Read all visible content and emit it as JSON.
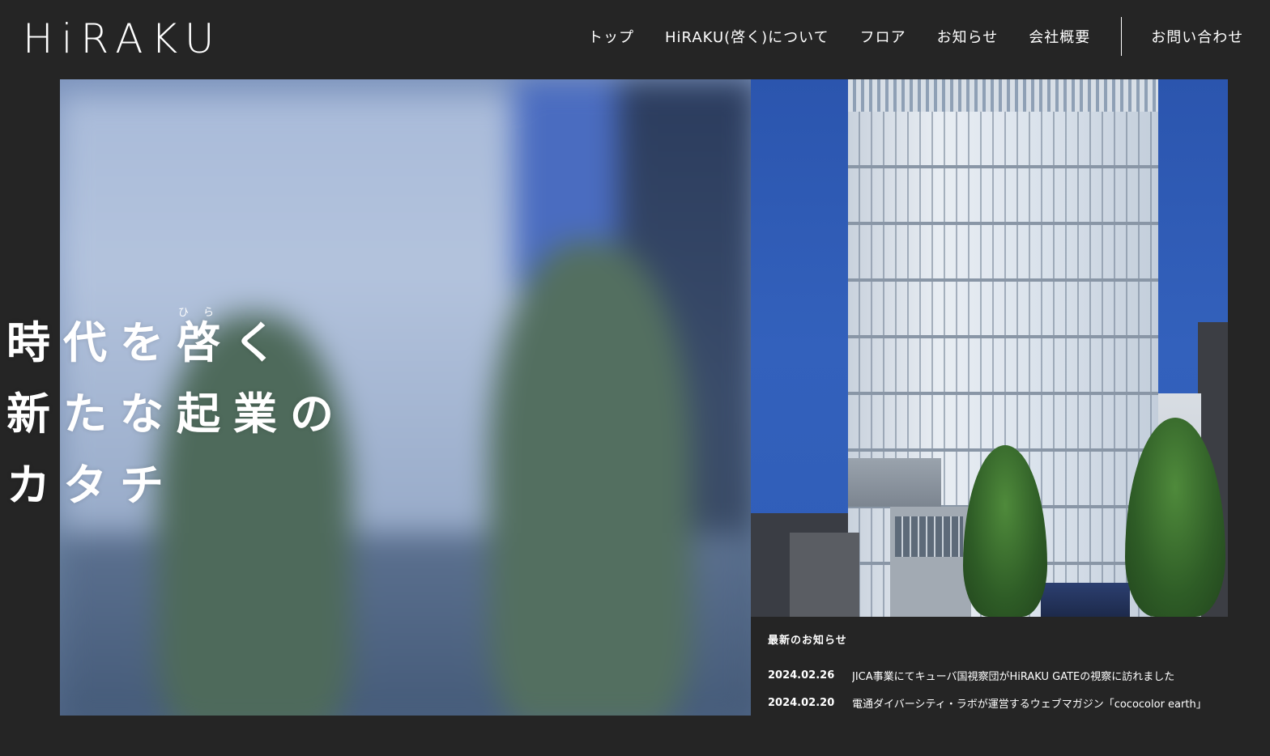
{
  "header": {
    "logo_text": "HiRAKU",
    "nav": [
      {
        "label": "トップ"
      },
      {
        "label": "HiRAKU(啓く)について"
      },
      {
        "label": "フロア"
      },
      {
        "label": "お知らせ"
      },
      {
        "label": "会社概要"
      },
      {
        "label": "お問い合わせ"
      }
    ]
  },
  "hero": {
    "ruby": "ひら",
    "line1": "時代を啓く",
    "line2": "新たな起業の",
    "line3": "カタチ"
  },
  "news": {
    "title": "最新のお知らせ",
    "items": [
      {
        "date": "2024.02.26",
        "text": "JICA事業にてキューバ国視察団がHiRAKU GATEの視察に訪れました"
      },
      {
        "date": "2024.02.20",
        "text": "電通ダイバーシティ・ラボが運営するウェブマガジン「cococolor earth」"
      }
    ]
  },
  "colors": {
    "background": "#252525",
    "logo_accent": "#8ec63f"
  }
}
